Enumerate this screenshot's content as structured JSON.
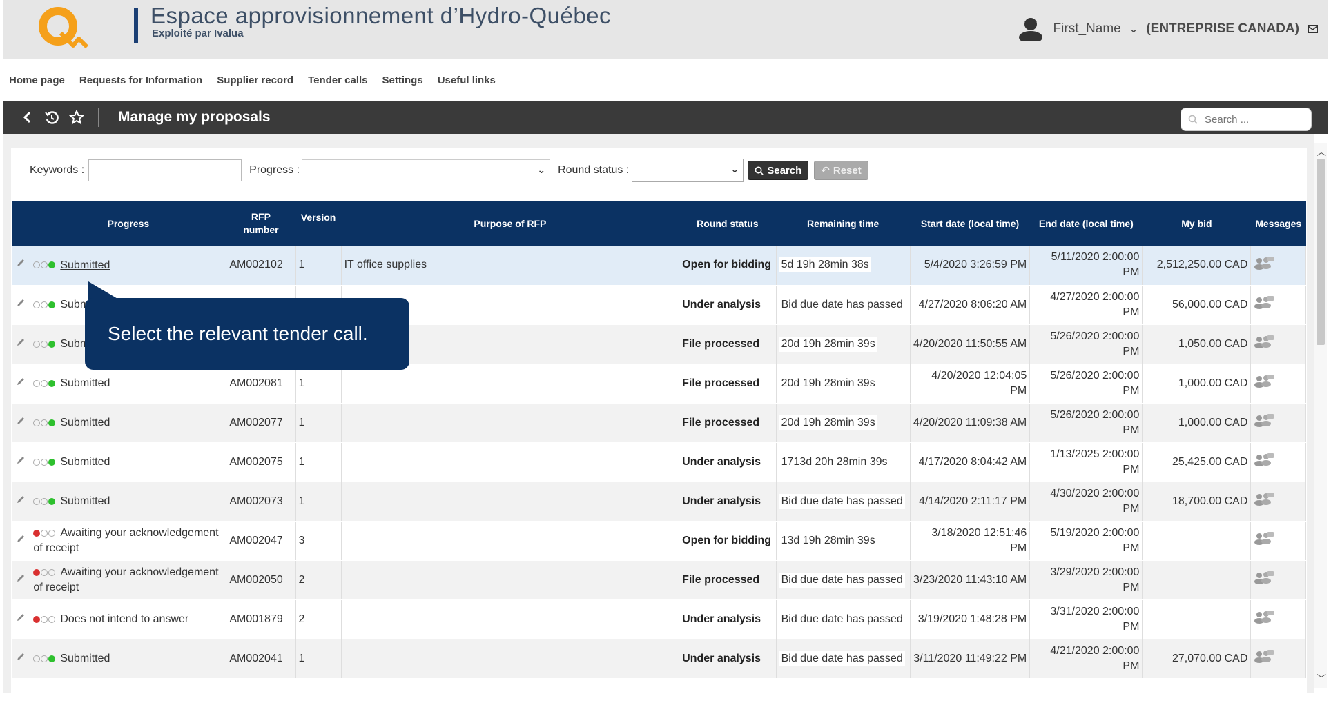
{
  "header": {
    "title": "Espace approvisionnement d’Hydro-Québec",
    "subtitle": "Exploité par Ivalua",
    "user_name": "First_Name",
    "company": "(ENTREPRISE CANADA)"
  },
  "nav": {
    "items": [
      "Home page",
      "Requests for Information",
      "Supplier record",
      "Tender calls",
      "Settings",
      "Useful links"
    ]
  },
  "toolbar": {
    "title": "Manage my proposals",
    "search_placeholder": "Search ..."
  },
  "filters": {
    "keywords_label": "Keywords :",
    "keywords_value": "",
    "progress_label": "Progress :",
    "progress_value": "",
    "round_status_label": "Round status :",
    "round_status_value": "",
    "search_button": "Search",
    "reset_button": "Reset"
  },
  "table": {
    "columns": {
      "progress": "Progress",
      "rfp_line1": "RFP",
      "rfp_line2": "number",
      "version": "Version",
      "purpose": "Purpose of RFP",
      "round_status": "Round status",
      "remaining": "Remaining time",
      "start": "Start date (local time)",
      "end": "End date (local time)",
      "bid": "My bid",
      "messages": "Messages"
    },
    "rows": [
      {
        "dots": "green",
        "progress": "Submitted",
        "rfp": "AM002102",
        "version": "1",
        "purpose": "IT office supplies",
        "round": "Open for bidding",
        "remaining": "5d 19h 28min 38s",
        "start": "5/4/2020 3:26:59 PM",
        "end": "5/11/2020 2:00:00 PM",
        "bid": "2,512,250.00 CAD"
      },
      {
        "dots": "green",
        "progress": "Submitted",
        "rfp": "",
        "version": "",
        "purpose": "",
        "round": "Under analysis",
        "remaining": "Bid due date has passed",
        "start": "4/27/2020 8:06:20 AM",
        "end": "4/27/2020 2:00:00 PM",
        "bid": "56,000.00 CAD"
      },
      {
        "dots": "green",
        "progress": "Submitted",
        "rfp": "",
        "version": "",
        "purpose": "",
        "round": "File processed",
        "remaining": "20d 19h 28min 39s",
        "start": "4/20/2020 11:50:55 AM",
        "end": "5/26/2020 2:00:00 PM",
        "bid": "1,050.00 CAD"
      },
      {
        "dots": "green",
        "progress": "Submitted",
        "rfp": "AM002081",
        "version": "1",
        "purpose": "",
        "round": "File processed",
        "remaining": "20d 19h 28min 39s",
        "start": "4/20/2020 12:04:05 PM",
        "end": "5/26/2020 2:00:00 PM",
        "bid": "1,000.00 CAD"
      },
      {
        "dots": "green",
        "progress": "Submitted",
        "rfp": "AM002077",
        "version": "1",
        "purpose": "",
        "round": "File processed",
        "remaining": "20d 19h 28min 39s",
        "start": "4/20/2020 11:09:38 AM",
        "end": "5/26/2020 2:00:00 PM",
        "bid": "1,000.00 CAD"
      },
      {
        "dots": "green",
        "progress": "Submitted",
        "rfp": "AM002075",
        "version": "1",
        "purpose": "",
        "round": "Under analysis",
        "remaining": "1713d 20h 28min 39s",
        "start": "4/17/2020 8:04:42 AM",
        "end": "1/13/2025 2:00:00 PM",
        "bid": "25,425.00 CAD"
      },
      {
        "dots": "green",
        "progress": "Submitted",
        "rfp": "AM002073",
        "version": "1",
        "purpose": "",
        "round": "Under analysis",
        "remaining": "Bid due date has passed",
        "start": "4/14/2020 2:11:17 PM",
        "end": "4/30/2020 2:00:00 PM",
        "bid": "18,700.00 CAD"
      },
      {
        "dots": "red",
        "progress": "Awaiting your acknowledgement of receipt",
        "rfp": "AM002047",
        "version": "3",
        "purpose": "",
        "round": "Open for bidding",
        "remaining": "13d 19h 28min 39s",
        "start": "3/18/2020 12:51:46 PM",
        "end": "5/19/2020 2:00:00 PM",
        "bid": ""
      },
      {
        "dots": "red",
        "progress": "Awaiting your acknowledgement of receipt",
        "rfp": "AM002050",
        "version": "2",
        "purpose": "",
        "round": "File processed",
        "remaining": "Bid due date has passed",
        "start": "3/23/2020 11:43:10 AM",
        "end": "3/29/2020 2:00:00 PM",
        "bid": ""
      },
      {
        "dots": "red",
        "progress": "Does not intend to answer",
        "rfp": "AM001879",
        "version": "2",
        "purpose": "",
        "round": "Under analysis",
        "remaining": "Bid due date has passed",
        "start": "3/19/2020 1:48:28 PM",
        "end": "3/31/2020 2:00:00 PM",
        "bid": ""
      },
      {
        "dots": "green",
        "progress": "Submitted",
        "rfp": "AM002041",
        "version": "1",
        "purpose": "",
        "round": "Under analysis",
        "remaining": "Bid due date has passed",
        "start": "3/11/2020 11:49:22 PM",
        "end": "4/21/2020 2:00:00 PM",
        "bid": "27,070.00 CAD"
      }
    ]
  },
  "callout": {
    "text": "Select the relevant tender call."
  },
  "colors": {
    "header_bg": "#0b3263",
    "toolbar_bg": "#3a3a3a",
    "logo_orange": "#f5a01a",
    "status_green": "#2ec02e",
    "status_red": "#d93030"
  }
}
